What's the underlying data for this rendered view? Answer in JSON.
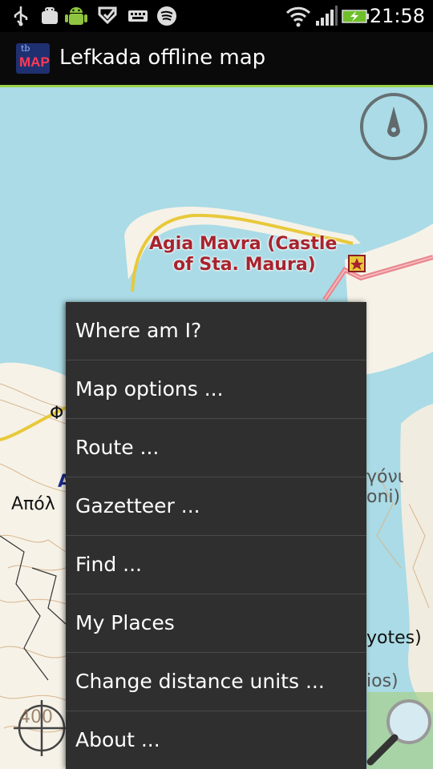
{
  "status_bar": {
    "time": "21:58",
    "icons": [
      "usb-icon",
      "android-debug-icon",
      "android-robot-icon",
      "tasks-icon",
      "keyboard-icon",
      "spotify-icon",
      "wifi-icon",
      "signal-icon",
      "battery-charging-icon"
    ]
  },
  "app": {
    "title": "Lefkada offline map",
    "icon_text_top": "tb",
    "icon_text_bottom": "MAP"
  },
  "map": {
    "labels": {
      "castle_line1": "Agia Mavra (Castle",
      "castle_line2": "of Sta. Maura)",
      "left_1": "Φ",
      "left_2": "Α",
      "left_3": "Απόλ",
      "right_1": "γόνι",
      "right_2": "oni)",
      "right_3": "yotes)",
      "right_4": "ios)",
      "scale": "400"
    },
    "colors": {
      "sea": "#aadbe6",
      "land": "#f6f2e8",
      "road": "#e8c93a",
      "highway": "#e8848c"
    }
  },
  "menu": {
    "items": [
      "Where am I?",
      "Map options ...",
      "Route ...",
      "Gazetteer ...",
      "Find ...",
      "My Places",
      "Change distance units ...",
      "About ..."
    ]
  }
}
